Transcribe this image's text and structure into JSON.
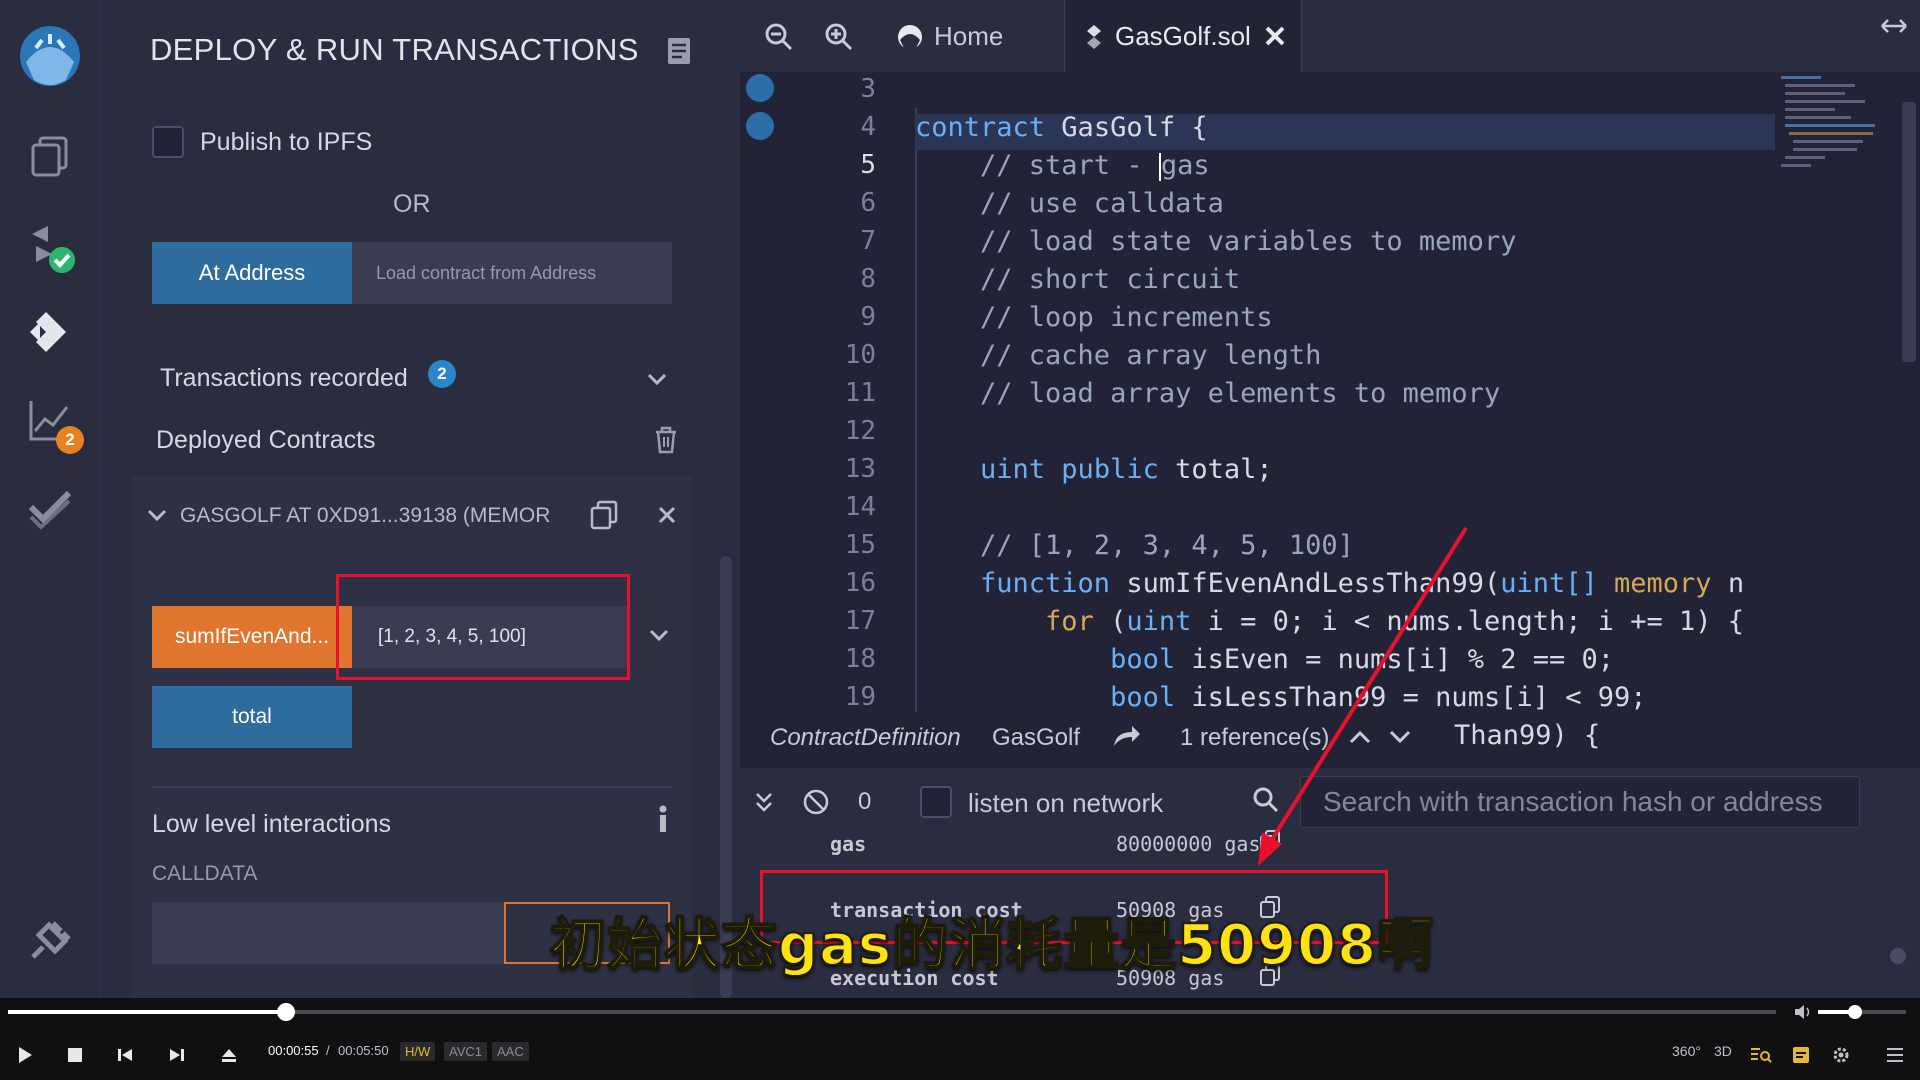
{
  "sidebar_badges": {
    "analytics": "2"
  },
  "panel": {
    "title": "DEPLOY & RUN TRANSACTIONS",
    "publish_ipfs": "Publish to IPFS",
    "or": "OR",
    "at_address_btn": "At Address",
    "load_contract_placeholder": "Load contract from Address",
    "transactions_recorded": "Transactions recorded",
    "transactions_count": "2",
    "deployed_contracts": "Deployed Contracts",
    "contract_instance": "GASGOLF AT 0XD91...39138 (MEMOR",
    "fn_button": "sumIfEvenAnd...",
    "fn_input_value": "[1, 2, 3, 4, 5, 100]",
    "total_button": "total",
    "low_level": "Low level interactions",
    "calldata": "CALLDATA"
  },
  "tabs": {
    "home": "Home",
    "file": "GasGolf.sol"
  },
  "editor": {
    "line_numbers": [
      "3",
      "4",
      "5",
      "6",
      "7",
      "8",
      "9",
      "10",
      "11",
      "12",
      "13",
      "14",
      "15",
      "16",
      "17",
      "18",
      "19"
    ],
    "lines": {
      "l4a": "contract",
      "l4b": " GasGolf {",
      "l5": "    // start - ",
      "l5b": "gas",
      "l6": "    // use calldata",
      "l7": "    // load state variables to memory",
      "l8": "    // short circuit",
      "l9": "    // loop increments",
      "l10": "    // cache array length",
      "l11": "    // load array elements to memory",
      "l13a": "    uint",
      "l13b": " public",
      "l13c": " total;",
      "l15": "    // [1, 2, 3, 4, 5, 100]",
      "l16a": "    function",
      "l16b": " sumIfEvenAndLessThan99(",
      "l16c": "uint[]",
      "l16d": " memory",
      "l16e": " n",
      "l17a": "        for",
      "l17b": " (",
      "l17c": "uint",
      "l17d": " i = 0; i < nums.length; i += 1) {",
      "l18a": "            bool",
      "l18b": " isEven = nums[i] % 2 == 0;",
      "l19a": "            bool",
      "l19b": " isLessThan99 = nums[i] < 99;"
    }
  },
  "definition": {
    "kind": "ContractDefinition",
    "name": "GasGolf",
    "refs": "1 reference(s)",
    "tail": "Than99) {"
  },
  "terminal": {
    "pending": "0",
    "listen": "listen on network",
    "search_placeholder": "Search with transaction hash or address",
    "gas_key": "gas",
    "gas_val": "80000000 gas",
    "tx_key": "transaction cost",
    "tx_val": "50908 gas",
    "exec_key": "execution cost",
    "exec_val": "50908 gas"
  },
  "subtitle": "初始状态gas的消耗量是50908啊",
  "player": {
    "time_current": "00:00:55",
    "time_sep": "/",
    "time_total": "00:05:50",
    "hw": "H/W",
    "vcodec": "AVC1",
    "acodec": "AAC",
    "r360": "360°",
    "r3d": "3D",
    "progress_fraction": 0.157
  },
  "colors": {
    "accent_blue": "#2f6c9e",
    "accent_orange": "#e0752f",
    "highlight_red": "#e8112d",
    "subtitle_yellow": "#ffe214"
  }
}
